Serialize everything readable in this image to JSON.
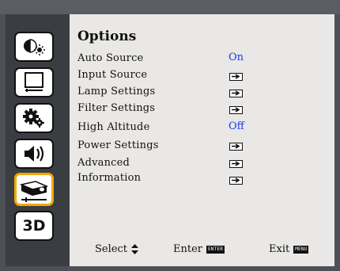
{
  "menu": {
    "title": "Options",
    "items": [
      {
        "label": "Auto Source",
        "value": "On",
        "kind": "value"
      },
      {
        "label": "Input Source",
        "kind": "submenu"
      },
      {
        "label": "Lamp Settings",
        "kind": "submenu"
      },
      {
        "label": "Filter Settings",
        "kind": "submenu"
      },
      {
        "label": "High Altitude",
        "value": "Off",
        "kind": "value"
      },
      {
        "label": "Power Settings",
        "kind": "submenu"
      },
      {
        "label": "Advanced",
        "kind": "submenu"
      },
      {
        "label": "Information",
        "kind": "submenu"
      }
    ]
  },
  "sidebar": {
    "tabs": [
      {
        "icon": "picture-brightness-icon"
      },
      {
        "icon": "display-screen-icon"
      },
      {
        "icon": "settings-gears-icon"
      },
      {
        "icon": "speaker-volume-icon"
      },
      {
        "icon": "projector-options-icon",
        "active": true
      },
      {
        "icon": "3d-icon",
        "label": "3D"
      }
    ]
  },
  "footer": {
    "select_label": "Select",
    "enter_label": "Enter",
    "enter_key": "ENTER",
    "exit_label": "Exit",
    "exit_key": "MENU"
  },
  "colors": {
    "active_tab_border": "#f2a900",
    "value_text": "#1a3cf0",
    "panel_bg": "#e9e8e6",
    "sidebar_bg": "#3a3d42"
  }
}
